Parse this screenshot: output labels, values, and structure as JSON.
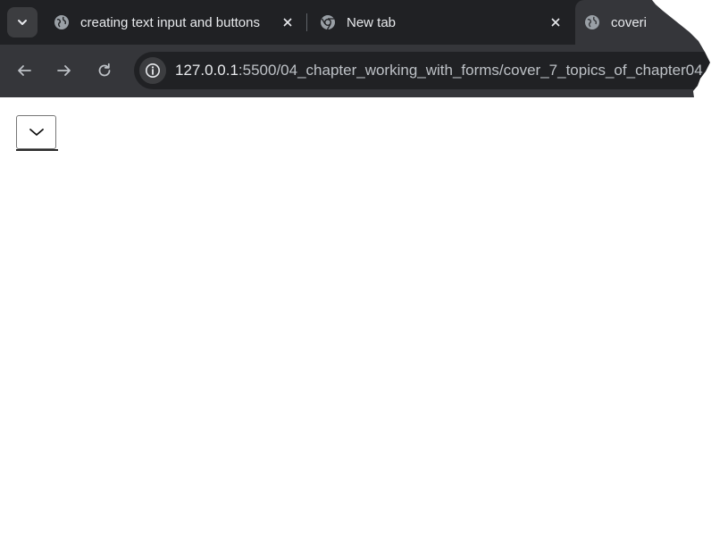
{
  "browser": {
    "tabs": [
      {
        "title": "creating text input and buttons",
        "favicon": "globe-icon",
        "active": false
      },
      {
        "title": "New tab",
        "favicon": "chrome-icon",
        "active": false
      },
      {
        "title": "coveri",
        "favicon": "globe-icon",
        "active": true
      }
    ],
    "address_bar": {
      "host": "127.0.0.1",
      "path": ":5500/04_chapter_working_with_forms/cover_7_topics_of_chapter04.",
      "info_icon": "info-icon"
    },
    "nav": {
      "back_icon": "arrow-left-icon",
      "forward_icon": "arrow-right-icon",
      "reload_icon": "reload-icon"
    },
    "colors": {
      "tab_strip": "#202124",
      "toolbar": "#35363a",
      "omnibox": "#202124",
      "text": "#e8eaed"
    }
  },
  "page": {
    "select": {
      "selected_value": "",
      "icon": "chevron-down-icon"
    }
  }
}
